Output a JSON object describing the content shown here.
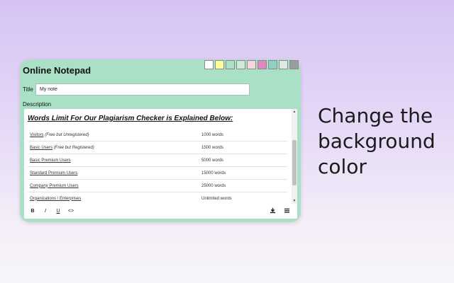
{
  "app": {
    "title": "Online Notepad",
    "title_label": "Title",
    "title_value": "My note",
    "description_label": "Description"
  },
  "swatches": [
    {
      "color": "#ffffff",
      "icon": "swatch-white"
    },
    {
      "color": "#fdfd99",
      "icon": "swatch-yellow"
    },
    {
      "color": "#a9e0c6",
      "icon": "swatch-green"
    },
    {
      "color": "#cfe8dc",
      "icon": "swatch-mint"
    },
    {
      "color": "#f5d6e0",
      "icon": "swatch-pink"
    },
    {
      "color": "#df86c4",
      "icon": "swatch-magenta"
    },
    {
      "color": "#8fcfc6",
      "icon": "swatch-teal"
    },
    {
      "color": "#dde9e6",
      "icon": "swatch-light-gray"
    },
    {
      "color": "#9c9c9c",
      "icon": "swatch-gray"
    }
  ],
  "document": {
    "heading": "Words Limit For Our Plagiarism Checker is Explained Below:",
    "rows": [
      {
        "tier": "Visitors",
        "note": "(Free but Unregistered)",
        "limit": "1000 words"
      },
      {
        "tier": "Basic Users",
        "note": "(Free but Registered)",
        "limit": "1500 words"
      },
      {
        "tier": "Basic Premium Users",
        "note": "",
        "limit": "5000 words"
      },
      {
        "tier": "Standard Premium Users",
        "note": "",
        "limit": "15000 words"
      },
      {
        "tier": "Company Premium Users",
        "note": "",
        "limit": "25000 words"
      },
      {
        "tier": "Organizations / Enterprises",
        "note": "",
        "limit": "Unlimited words"
      }
    ]
  },
  "toolbar": {
    "bold": "B",
    "italic": "I",
    "underline": "U",
    "code": "<>",
    "download_icon": "download-icon",
    "menu_icon": "menu-icon"
  },
  "caption": {
    "line1": "Change the",
    "line2": "background",
    "line3": "color"
  }
}
